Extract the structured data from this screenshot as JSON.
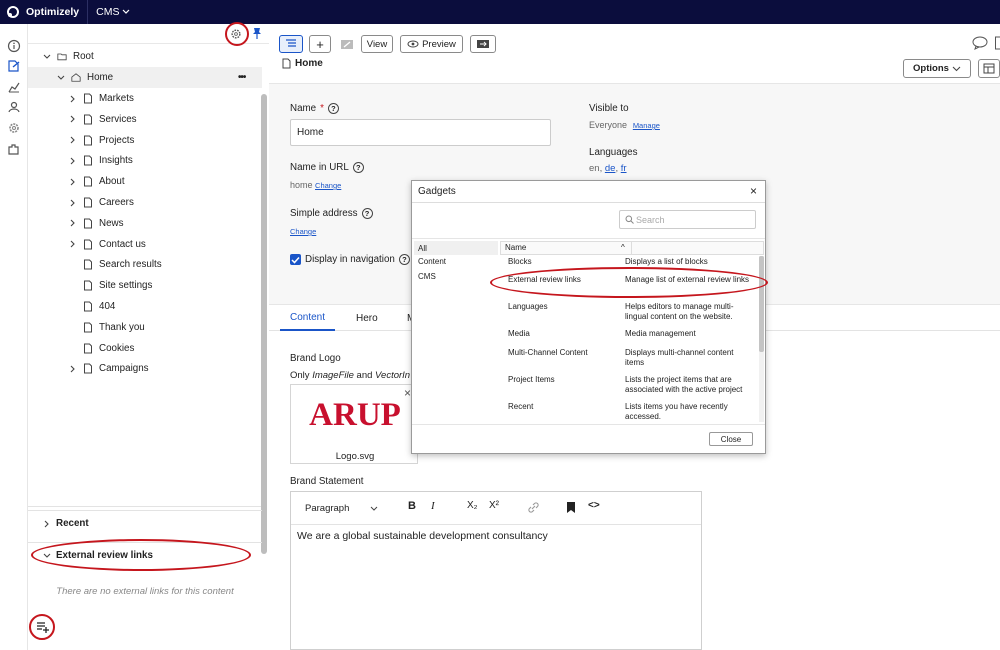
{
  "topbar": {
    "brand": "Optimizely",
    "product": "CMS"
  },
  "navigation_tree": {
    "root": "Root",
    "home": "Home",
    "home_more": "•••",
    "children": [
      {
        "label": "Markets",
        "expandable": true
      },
      {
        "label": "Services",
        "expandable": true
      },
      {
        "label": "Projects",
        "expandable": true
      },
      {
        "label": "Insights",
        "expandable": true
      },
      {
        "label": "About",
        "expandable": true
      },
      {
        "label": "Careers",
        "expandable": true
      },
      {
        "label": "News",
        "expandable": true
      },
      {
        "label": "Contact us",
        "expandable": true
      },
      {
        "label": "Search results",
        "expandable": false
      },
      {
        "label": "Site settings",
        "expandable": false
      },
      {
        "label": "404",
        "expandable": false
      },
      {
        "label": "Thank you",
        "expandable": false
      },
      {
        "label": "Cookies",
        "expandable": false
      },
      {
        "label": "Campaigns",
        "expandable": true
      }
    ],
    "tools_more": "•••"
  },
  "gadgets": {
    "recent": "Recent",
    "external_review_links": "External review links",
    "empty_message": "There are no external links for this content"
  },
  "toolbar": {
    "view": "View",
    "preview": "Preview",
    "options": "Options"
  },
  "page": {
    "title": "Home",
    "name_label": "Name",
    "name_required": "*",
    "name_value": "Home",
    "url_label": "Name in URL",
    "url_value": "home",
    "url_change": "Change",
    "simple_address_label": "Simple address",
    "simple_address_change": "Change",
    "display_in_nav_label": "Display in navigation",
    "display_in_nav_checked": true,
    "visible_to_label": "Visible to",
    "visible_to_value": "Everyone",
    "visible_to_manage": "Manage",
    "languages_label": "Languages",
    "languages": [
      "en",
      "de",
      "fr"
    ],
    "help_glyph": "?"
  },
  "tabs": [
    "Content",
    "Hero",
    "M"
  ],
  "content": {
    "brand_logo_label": "Brand Logo",
    "brand_logo_hint_prefix": "Only ",
    "brand_logo_hint_type1": "ImageFile",
    "brand_logo_hint_and": " and ",
    "brand_logo_hint_type2": "VectorIn",
    "logo_text": "ARUP",
    "logo_caption": "Logo.svg",
    "logo_remove": "×",
    "brand_statement_label": "Brand Statement",
    "paragraph_format": "Paragraph",
    "statement_text": "We are a global sustainable development consultancy",
    "rte_bold": "B",
    "rte_italic": "I",
    "rte_sub": "X₂",
    "rte_sup": "X²",
    "rte_code": "<>"
  },
  "gadgets_dialog": {
    "title": "Gadgets",
    "close_x": "×",
    "search_placeholder": "Search",
    "categories": [
      "All",
      "Content",
      "CMS"
    ],
    "column_header": "Name",
    "sort_glyph": "^",
    "items": [
      {
        "name": "Blocks",
        "description": "Displays a list of blocks"
      },
      {
        "name": "External review links",
        "description": "Manage list of external review links"
      },
      {
        "name": "Languages",
        "description": "Helps editors to manage multi-lingual content on the website."
      },
      {
        "name": "Media",
        "description": "Media management"
      },
      {
        "name": "Multi-Channel Content",
        "description": "Displays multi-channel content items"
      },
      {
        "name": "Project Items",
        "description": "Lists the project items that are associated with the active project"
      },
      {
        "name": "Recent",
        "description": "Lists items you have recently accessed."
      }
    ],
    "close_button": "Close"
  },
  "colors": {
    "topbar": "#0b0d3d",
    "accent": "#1a55c8",
    "highlight_ring": "#c5161d",
    "logo_red": "#c8102e"
  }
}
